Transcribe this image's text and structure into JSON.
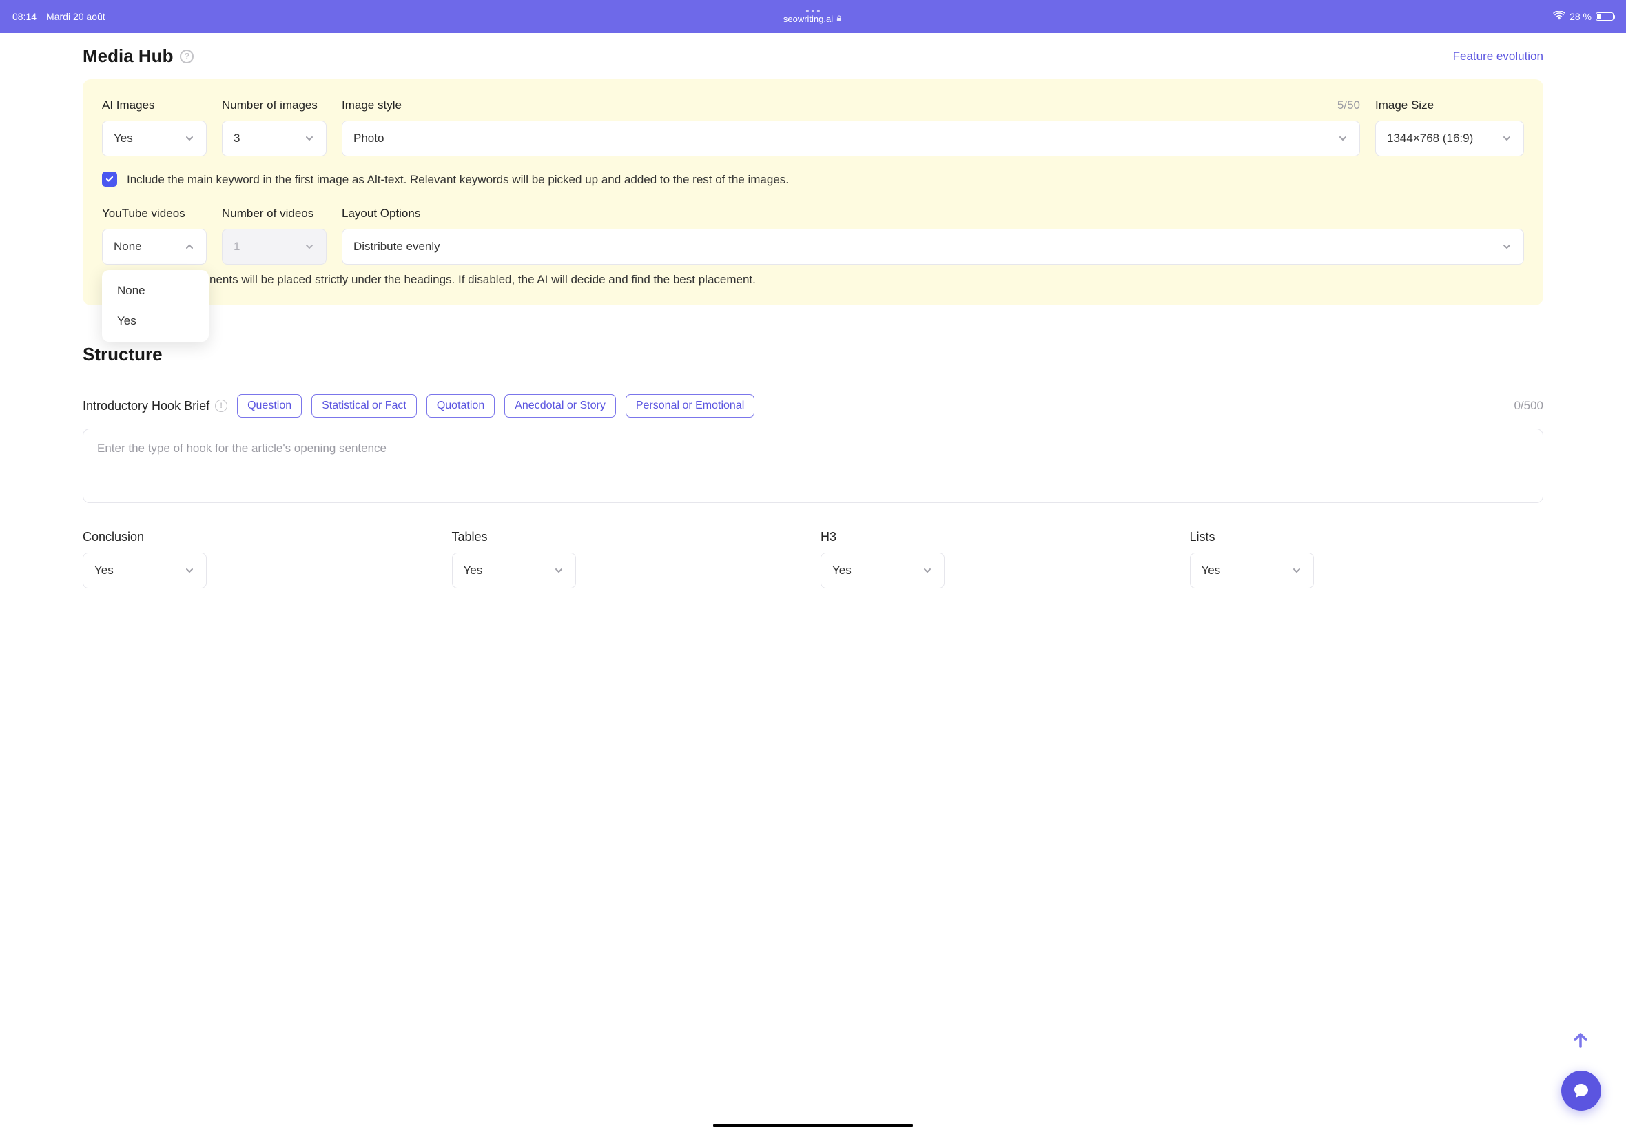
{
  "status": {
    "time": "08:14",
    "date": "Mardi 20 août",
    "domain": "seowriting.ai",
    "battery_percent": "28 %"
  },
  "header": {
    "title": "Media Hub",
    "feature_link": "Feature evolution"
  },
  "media": {
    "ai_images_label": "AI Images",
    "ai_images_value": "Yes",
    "num_images_label": "Number of images",
    "num_images_value": "3",
    "image_style_label": "Image style",
    "image_style_value": "Photo",
    "image_style_counter": "5/50",
    "image_size_label": "Image Size",
    "image_size_value": "1344×768 (16:9)",
    "alt_text_checkbox": "Include the main keyword in the first image as Alt-text. Relevant keywords will be picked up and added to the rest of the images.",
    "youtube_label": "YouTube videos",
    "youtube_value": "None",
    "youtube_options": [
      "None",
      "Yes"
    ],
    "num_videos_label": "Number of videos",
    "num_videos_value": "1",
    "layout_label": "Layout Options",
    "layout_value": "Distribute evenly",
    "placement_helper": "nents will be placed strictly under the headings. If disabled, the AI will decide and find the best placement."
  },
  "structure": {
    "title": "Structure",
    "hook_label": "Introductory Hook Brief",
    "hook_counter": "0/500",
    "hook_placeholder": "Enter the type of hook for the article's opening sentence",
    "chips": [
      "Question",
      "Statistical or Fact",
      "Quotation",
      "Anecdotal or Story",
      "Personal or Emotional"
    ],
    "conclusion_label": "Conclusion",
    "conclusion_value": "Yes",
    "tables_label": "Tables",
    "tables_value": "Yes",
    "h3_label": "H3",
    "h3_value": "Yes",
    "lists_label": "Lists",
    "lists_value": "Yes"
  }
}
